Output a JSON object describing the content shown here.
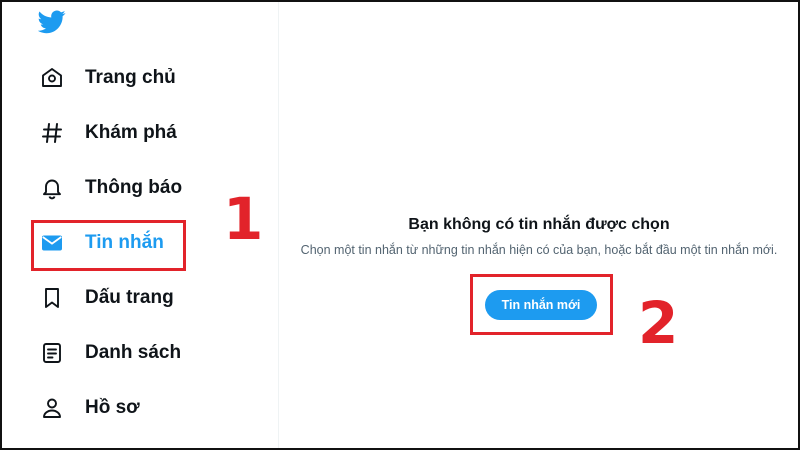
{
  "sidebar": {
    "logo_icon": "twitter-bird-icon",
    "items": [
      {
        "label": "Trang chủ",
        "icon": "home-icon"
      },
      {
        "label": "Khám phá",
        "icon": "hashtag-icon"
      },
      {
        "label": "Thông báo",
        "icon": "bell-icon"
      },
      {
        "label": "Tin nhắn",
        "icon": "mail-icon",
        "active": true
      },
      {
        "label": "Dấu trang",
        "icon": "bookmark-icon"
      },
      {
        "label": "Danh sách",
        "icon": "list-icon"
      },
      {
        "label": "Hồ sơ",
        "icon": "person-icon"
      }
    ]
  },
  "main": {
    "empty_title": "Bạn không có tin nhắn được chọn",
    "empty_description": "Chọn một tin nhắn từ những tin nhắn hiện có của bạn, hoặc bắt đầu một tin nhắn mới.",
    "new_message_button": "Tin nhắn mới"
  },
  "annotations": {
    "step1": "1",
    "step2": "2"
  },
  "colors": {
    "accent": "#1d9bf0",
    "text": "#0f1419",
    "muted": "#536471",
    "annotation": "#e2232a"
  }
}
